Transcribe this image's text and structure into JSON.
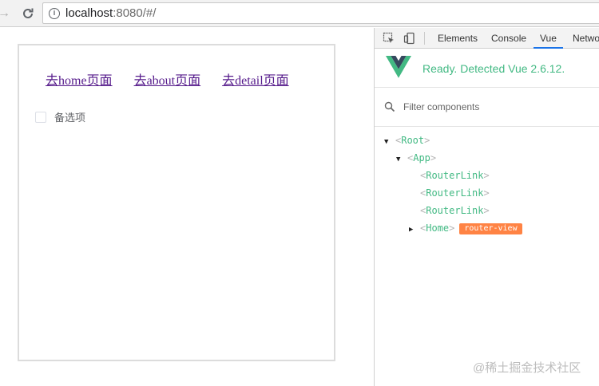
{
  "browser": {
    "url_host": "localhost",
    "url_rest": ":8080/#/"
  },
  "app": {
    "links": [
      "去home页面",
      "去about页面",
      "去detail页面"
    ],
    "checkbox_label": "备选项"
  },
  "devtools": {
    "tabs": [
      "Elements",
      "Console",
      "Vue",
      "Netwo"
    ],
    "active_tab": "Vue",
    "vue_status": "Ready. Detected Vue 2.6.12.",
    "filter_placeholder": "Filter components",
    "tree": {
      "root": "Root",
      "app": "App",
      "router_links": [
        "RouterLink",
        "RouterLink",
        "RouterLink"
      ],
      "home": "Home",
      "home_badge": "router-view"
    }
  },
  "watermark": "@稀土掘金技术社区",
  "colors": {
    "vue_green": "#42b983",
    "badge_orange": "#ff8344",
    "visited_link": "#551a8b"
  }
}
